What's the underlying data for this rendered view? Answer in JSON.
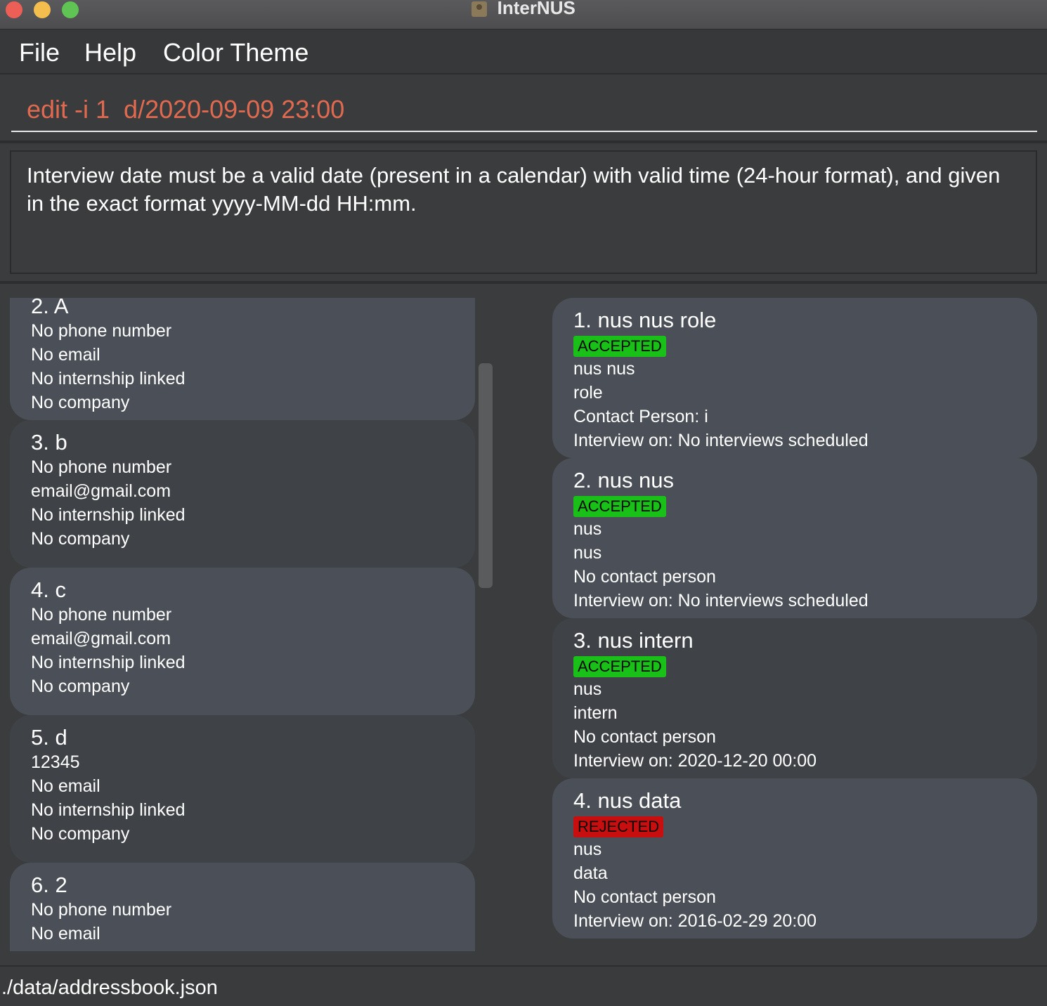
{
  "window": {
    "title": "InterNUS"
  },
  "menu": {
    "file": "File",
    "help": "Help",
    "color_theme": "Color Theme"
  },
  "command": {
    "value": "edit -i 1  d/2020-09-09 23:00",
    "color": "#e06a50"
  },
  "result": {
    "text": "Interview date must be a valid date (present in a calendar) with valid time (24-hour format), and given in the exact format yyyy-MM-dd HH:mm."
  },
  "persons": [
    {
      "heading": "2.  A",
      "lines": [
        "No phone number",
        "No email",
        "No internship linked",
        "No company"
      ]
    },
    {
      "heading": "3.  b",
      "lines": [
        "No phone number",
        "email@gmail.com",
        "No internship linked",
        "No company"
      ]
    },
    {
      "heading": "4.  c",
      "lines": [
        "No phone number",
        "email@gmail.com",
        "No internship linked",
        "No company"
      ]
    },
    {
      "heading": "5.  d",
      "lines": [
        "12345",
        "No email",
        "No internship linked",
        "No company"
      ]
    },
    {
      "heading": "6.  2",
      "lines": [
        "No phone number",
        "No email",
        "",
        ""
      ]
    }
  ],
  "internships": [
    {
      "heading": "1.  nus  nus role",
      "status": "ACCEPTED",
      "lines": [
        "nus  nus",
        "role",
        "Contact Person: i",
        "Interview on: No interviews scheduled"
      ]
    },
    {
      "heading": "2.  nus nus",
      "status": "ACCEPTED",
      "lines": [
        "nus",
        "nus",
        "No contact person",
        "Interview on: No interviews scheduled"
      ]
    },
    {
      "heading": "3.  nus intern",
      "status": "ACCEPTED",
      "lines": [
        "nus",
        "intern",
        "No contact person",
        "Interview on: 2020-12-20 00:00"
      ]
    },
    {
      "heading": "4.  nus data",
      "status": "REJECTED",
      "lines": [
        "nus",
        "data",
        "No contact person",
        "Interview on: 2016-02-29 20:00"
      ]
    }
  ],
  "status_colors": {
    "accepted": "#18c018",
    "rejected": "#c80e0e"
  },
  "statusbar": {
    "path": "./data/addressbook.json"
  }
}
